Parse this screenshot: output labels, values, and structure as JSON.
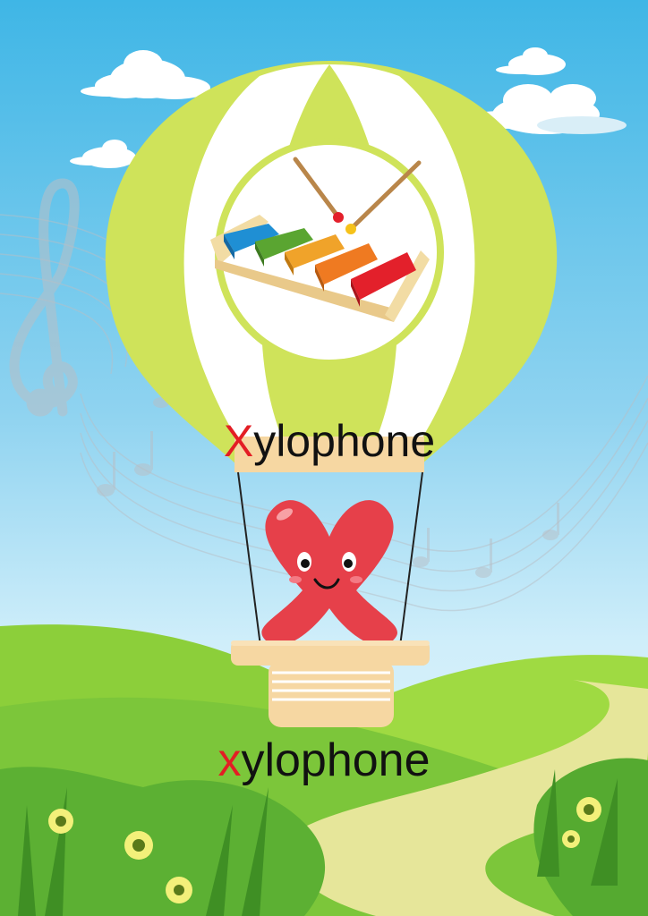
{
  "word_upper": {
    "first_letter": "X",
    "rest": "ylophone"
  },
  "word_lower": {
    "first_letter": "x",
    "rest": "ylophone"
  },
  "colors": {
    "first_letter": "#e31e24",
    "word_text": "#111111",
    "sky_top": "#3fb6e6",
    "balloon_green": "#cfe35a",
    "balloon_white": "#ffffff",
    "basket": "#f6d7a2",
    "letter_character": "#e6404a",
    "grass": "#6cc23a"
  },
  "icons": [
    "cloud-icon",
    "treble-clef-icon",
    "music-notes-icon",
    "hot-air-balloon-icon",
    "xylophone-icon",
    "mallet-icon",
    "letter-x-character-icon",
    "basket-icon",
    "flower-icon"
  ]
}
